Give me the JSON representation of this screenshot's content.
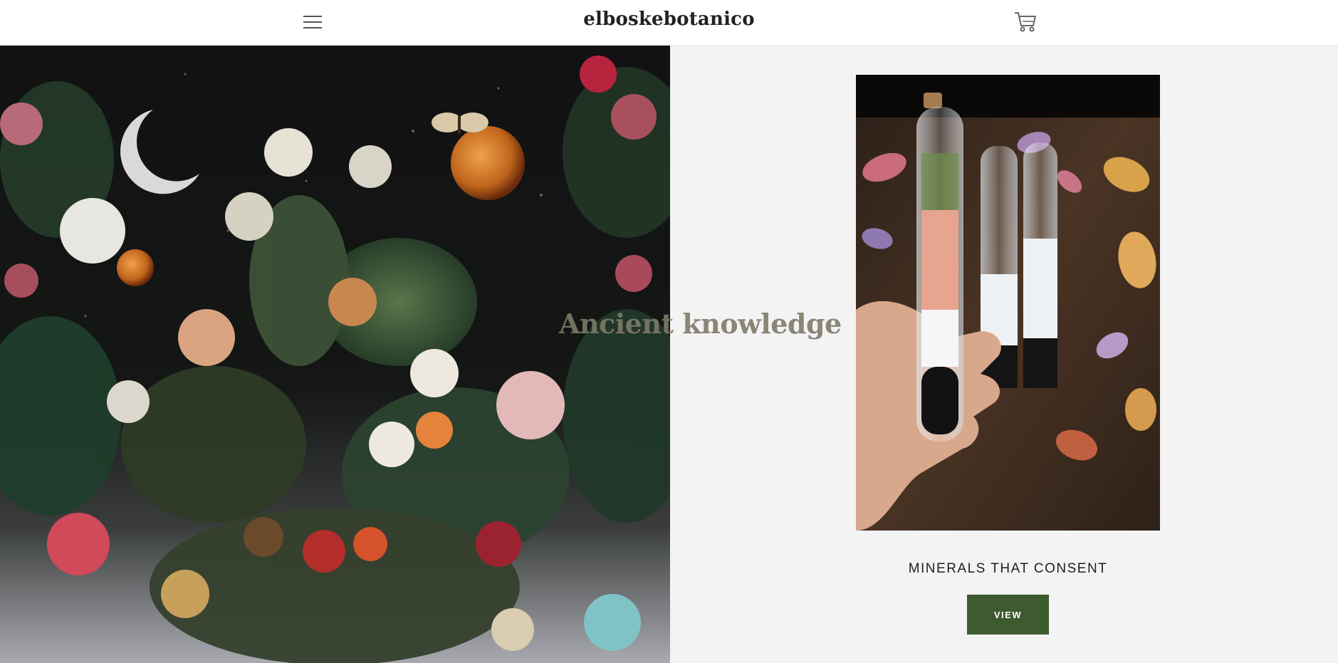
{
  "header": {
    "brand": "elboskebotanico",
    "menu_icon": "hamburger-menu-icon",
    "cart_icon": "shopping-cart-icon"
  },
  "hero": {
    "headline": "Ancient knowledge",
    "left_image": "dark-botanical-illustration-with-moon-and-planets"
  },
  "feature": {
    "product_image": "hand-holding-glass-vial-with-minerals-and-herbs",
    "title": "MINERALS THAT CONSENT",
    "button_label": "VIEW"
  },
  "colors": {
    "accent": "#3e5a2f",
    "headline": "#7f7a68",
    "panel_bg": "#f3f3f3",
    "header_bg": "#ffffff"
  }
}
